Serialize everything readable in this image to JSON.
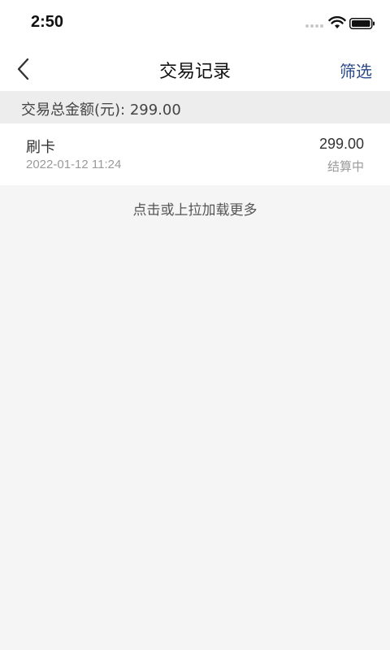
{
  "status_bar": {
    "time": "2:50"
  },
  "nav": {
    "title": "交易记录",
    "filter_label": "筛选"
  },
  "summary": {
    "text": "交易总金额(元): 299.00"
  },
  "records": [
    {
      "type": "刷卡",
      "date": "2022-01-12 11:24",
      "amount": "299.00",
      "status": "结算中"
    }
  ],
  "load_more_label": "点击或上拉加载更多",
  "colors": {
    "accent": "#2c4a8a",
    "background": "#f5f5f5"
  }
}
